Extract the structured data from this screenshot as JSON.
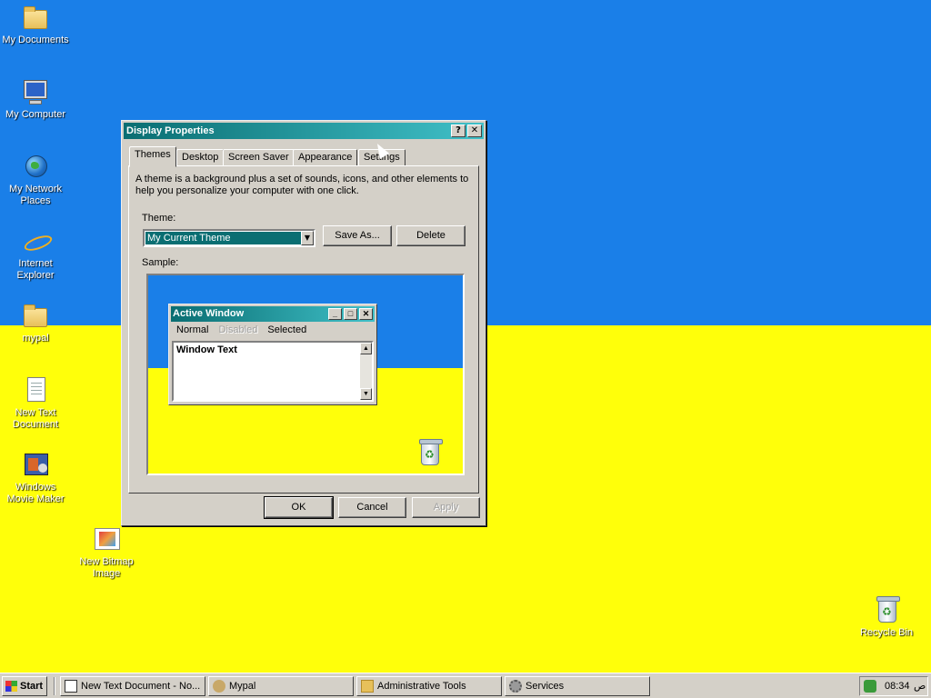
{
  "desktop": {
    "icons": [
      {
        "label": "My Documents",
        "icon": "my-documents-icon"
      },
      {
        "label": "My Computer",
        "icon": "my-computer-icon"
      },
      {
        "label": "My Network Places",
        "icon": "network-places-icon"
      },
      {
        "label": "Internet Explorer",
        "icon": "internet-explorer-icon"
      },
      {
        "label": "mypal",
        "icon": "folder-icon"
      },
      {
        "label": "New Text Document",
        "icon": "text-document-icon"
      },
      {
        "label": "Windows Movie Maker",
        "icon": "movie-maker-icon"
      },
      {
        "label": "New Bitmap Image",
        "icon": "bitmap-image-icon"
      },
      {
        "label": "Recycle Bin",
        "icon": "recycle-bin-icon"
      }
    ],
    "colors": {
      "top": "#1a7fe8",
      "bottom": "#ffff0a"
    }
  },
  "dialog": {
    "title": "Display Properties",
    "help_button": "?",
    "close_button": "✕",
    "tabs": [
      "Themes",
      "Desktop",
      "Screen Saver",
      "Appearance",
      "Settings"
    ],
    "active_tab": "Themes",
    "description": "A theme is a background plus a set of sounds, icons, and other elements to help you personalize your computer with one click.",
    "theme_label": "Theme:",
    "theme_value": "My Current Theme",
    "save_as_label": "Save As...",
    "delete_label": "Delete",
    "sample_label": "Sample:",
    "sample": {
      "window_title": "Active Window",
      "menu_normal": "Normal",
      "menu_disabled": "Disabled",
      "menu_selected": "Selected",
      "window_text": "Window Text"
    },
    "ok_label": "OK",
    "cancel_label": "Cancel",
    "apply_label": "Apply"
  },
  "taskbar": {
    "start_label": "Start",
    "tasks": [
      {
        "label": "New Text Document - No...",
        "icon": "notepad-icon"
      },
      {
        "label": "Mypal",
        "icon": "mypal-icon"
      },
      {
        "label": "Administrative Tools",
        "icon": "folder-icon"
      },
      {
        "label": "Services",
        "icon": "services-icon"
      }
    ],
    "clock": "08:34",
    "ampm": "ص"
  },
  "colors": {
    "title_active": "#0a6e72",
    "face": "#d4d0c8"
  }
}
